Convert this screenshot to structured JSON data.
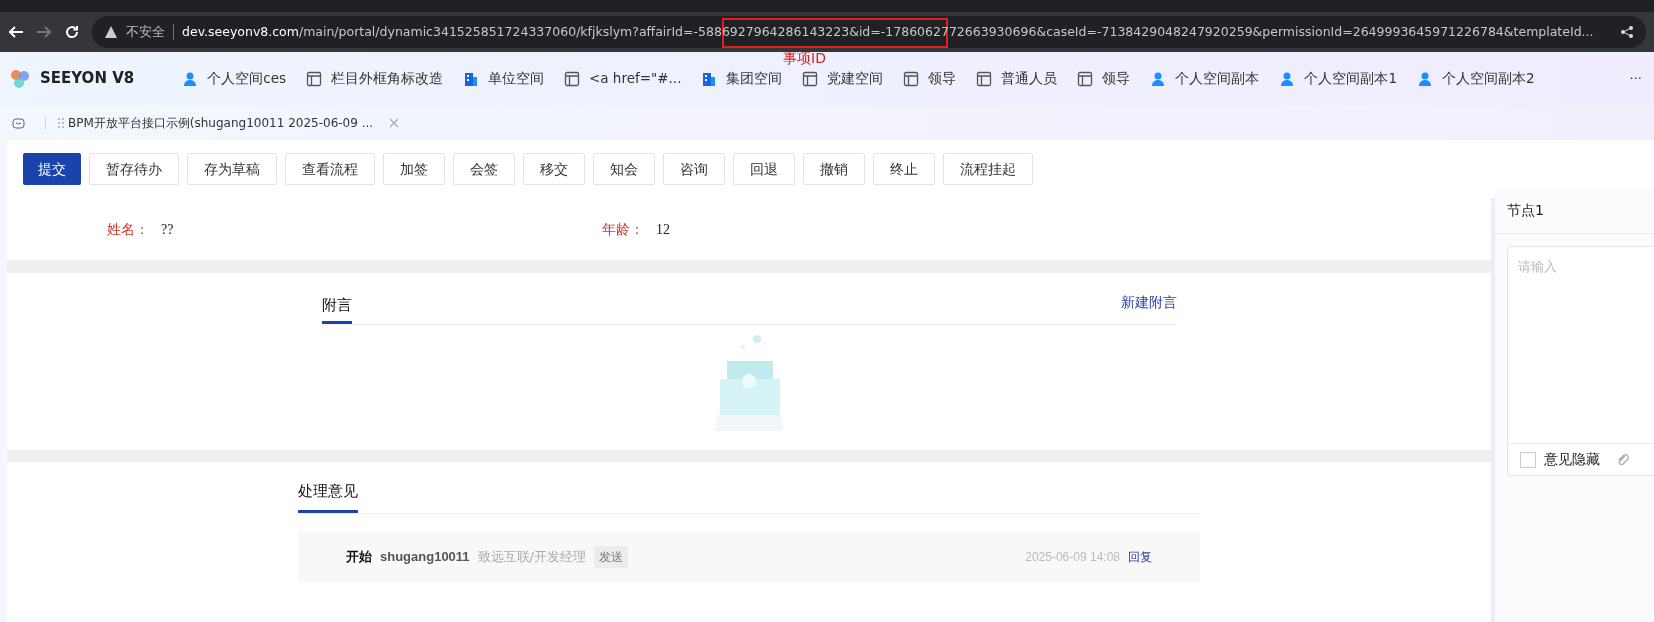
{
  "browser": {
    "security": "不安全",
    "url_host": "dev.seeyonv8.com",
    "url_path": "/main/portal/dynamic341525851724337060/kfjkslym?affairId=-5886927964286143223&id=-1786062772663930696&caseId=-7138429048247920259&permissionId=2649993645971226784&templateId...",
    "annotation": "事项ID"
  },
  "header": {
    "logo": "SEEYON V8",
    "nav": [
      {
        "label": "个人空间ces",
        "kind": "user"
      },
      {
        "label": "栏目外框角标改造",
        "kind": "layout"
      },
      {
        "label": "单位空间",
        "kind": "building"
      },
      {
        "label": "<a href=\"#...",
        "kind": "layout"
      },
      {
        "label": "集团空间",
        "kind": "building"
      },
      {
        "label": "党建空间",
        "kind": "layout"
      },
      {
        "label": "领导",
        "kind": "layout"
      },
      {
        "label": "普通人员",
        "kind": "layout"
      },
      {
        "label": "领导",
        "kind": "layout"
      },
      {
        "label": "个人空间副本",
        "kind": "user"
      },
      {
        "label": "个人空间副本1",
        "kind": "user"
      },
      {
        "label": "个人空间副本2",
        "kind": "user"
      }
    ],
    "more": "···"
  },
  "page_tab": {
    "label": "BPM开放平台接口示例(shugang10011 2025-06-09 ..."
  },
  "toolbar": [
    {
      "label": "提交",
      "primary": true
    },
    {
      "label": "暂存待办",
      "primary": false
    },
    {
      "label": "存为草稿",
      "primary": false
    },
    {
      "label": "查看流程",
      "primary": false
    },
    {
      "label": "加签",
      "primary": false
    },
    {
      "label": "会签",
      "primary": false
    },
    {
      "label": "移交",
      "primary": false
    },
    {
      "label": "知会",
      "primary": false
    },
    {
      "label": "咨询",
      "primary": false
    },
    {
      "label": "回退",
      "primary": false
    },
    {
      "label": "撤销",
      "primary": false
    },
    {
      "label": "终止",
      "primary": false
    },
    {
      "label": "流程挂起",
      "primary": false
    }
  ],
  "form": [
    {
      "label": "姓名：",
      "value": "??"
    },
    {
      "label": "年龄：",
      "value": "12"
    }
  ],
  "attachments": {
    "tab": "附言",
    "action": "新建附言"
  },
  "opinions": {
    "tab": "处理意见",
    "entries": [
      {
        "action": "开始",
        "user": "shugang10011",
        "dept": "致远互联/开发经理",
        "tag": "发送",
        "time": "2025-06-09 14:08",
        "reply": "回复"
      }
    ]
  },
  "side": {
    "title": "节点1",
    "placeholder": "请输入",
    "hide_label": "意见隐藏",
    "hide_checked": false
  }
}
